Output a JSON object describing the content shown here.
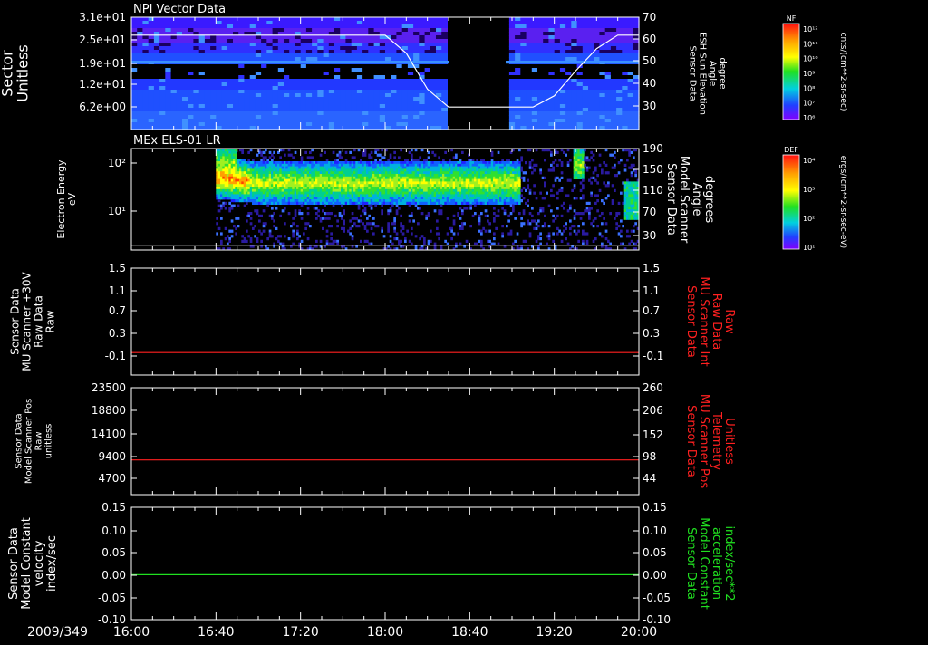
{
  "date_label": "2009/349",
  "x_axis": {
    "range": [
      "16:00",
      "20:00"
    ],
    "ticks": [
      "16:00",
      "16:40",
      "17:20",
      "18:00",
      "18:40",
      "19:20",
      "20:00"
    ]
  },
  "colors": {
    "background": "#000000",
    "axes": "#ffffff",
    "red_trace": "#ff2020",
    "green_trace": "#20e020"
  },
  "chart_data": [
    {
      "type": "heatmap",
      "title": "NPI Vector Data",
      "ylabel": [
        "Sector",
        "Unitless"
      ],
      "y_ticks": [
        "3.1e+01",
        "2.5e+01",
        "1.9e+01",
        "1.2e+01",
        "6.2e+00"
      ],
      "y2label": [
        "Sensor Data",
        "ESH Sun Elevation",
        "Angle",
        "degree"
      ],
      "y2_ticks": [
        "70",
        "60",
        "50",
        "40",
        "30"
      ],
      "y2lim": [
        20,
        70
      ],
      "gap": [
        "18:30",
        "18:57"
      ],
      "overlay_line": {
        "name": "ESH Sun Elevation Angle",
        "x": [
          "16:00",
          "18:00",
          "18:10",
          "18:20",
          "18:30",
          "19:10",
          "19:20",
          "19:30",
          "19:40",
          "19:50",
          "20:00"
        ],
        "y": [
          62,
          62,
          54,
          38,
          30,
          30,
          35,
          46,
          56,
          62,
          62
        ]
      },
      "colorbar": {
        "label": "NF",
        "units": "cnts/(cm**2-sr-sec)",
        "ticks": [
          "10¹²",
          "10¹¹",
          "10¹⁰",
          "10⁹",
          "10⁸",
          "10⁷",
          "10⁶"
        ]
      }
    },
    {
      "type": "heatmap",
      "title": "MEx ELS-01 LR",
      "ylabel": [
        "Electron Energy",
        "eV"
      ],
      "y_ticks": [
        "10²",
        "10¹"
      ],
      "y2label": [
        "Sensor Data",
        "Model Scanner",
        "Angle",
        "degrees"
      ],
      "y2_ticks": [
        "190",
        "150",
        "110",
        "70",
        "30"
      ],
      "y2lim": [
        0,
        190
      ],
      "data_start": "16:40",
      "overlay_line": {
        "name": "Model Scanner Angle",
        "x": [
          "16:00",
          "20:00"
        ],
        "y": [
          9,
          9
        ]
      },
      "colorbar": {
        "label": "DEF",
        "units": "ergs/(cm**2-sr-sec-eV)",
        "ticks": [
          "10⁴",
          "10³",
          "10²",
          "10¹"
        ]
      }
    },
    {
      "type": "line",
      "ylabel": [
        "Sensor Data",
        "MU Scanner +30V",
        "Raw Data",
        "Raw"
      ],
      "y_ticks": [
        "1.5",
        "1.1",
        "0.7",
        "0.3",
        "-0.1"
      ],
      "ylim": [
        -0.4,
        1.5
      ],
      "y2label": [
        "Sensor Data",
        "MU Scanner Int",
        "Raw Data",
        "Raw"
      ],
      "y2_ticks": [
        "1.5",
        "1.1",
        "0.7",
        "0.3",
        "-0.1"
      ],
      "series": [
        {
          "x": [
            "16:00",
            "20:00"
          ],
          "values": [
            0.0,
            0.0
          ],
          "color": "#ff2020"
        }
      ]
    },
    {
      "type": "line",
      "ylabel": [
        "Sensor Data",
        "Model Scanner Pos",
        "Raw",
        "unitless"
      ],
      "y_ticks": [
        "23500",
        "18800",
        "14100",
        "9400",
        "4700"
      ],
      "ylim": [
        1000,
        23500
      ],
      "y2label": [
        "Sensor Data",
        "MU Scanner Pos",
        "Telemetry",
        "Unitless"
      ],
      "y2_ticks": [
        "260",
        "206",
        "152",
        "98",
        "44"
      ],
      "series": [
        {
          "x": [
            "16:00",
            "20:00"
          ],
          "values": [
            8300,
            8300
          ],
          "color": "#ff2020"
        }
      ]
    },
    {
      "type": "line",
      "ylabel": [
        "Sensor Data",
        "Model Constant",
        "velocity",
        "index/sec"
      ],
      "y_ticks": [
        "0.15",
        "0.10",
        "0.05",
        "0.00",
        "-0.05",
        "-0.10"
      ],
      "ylim": [
        -0.1,
        0.15
      ],
      "y2label": [
        "Sensor Data",
        "Model Constant",
        "acceleration",
        "index/sec**2"
      ],
      "y2_ticks": [
        "0.15",
        "0.10",
        "0.05",
        "0.00",
        "-0.05",
        "-0.10"
      ],
      "series": [
        {
          "x": [
            "16:00",
            "20:00"
          ],
          "values": [
            0.0,
            0.0
          ],
          "color": "#20e020"
        }
      ]
    }
  ]
}
